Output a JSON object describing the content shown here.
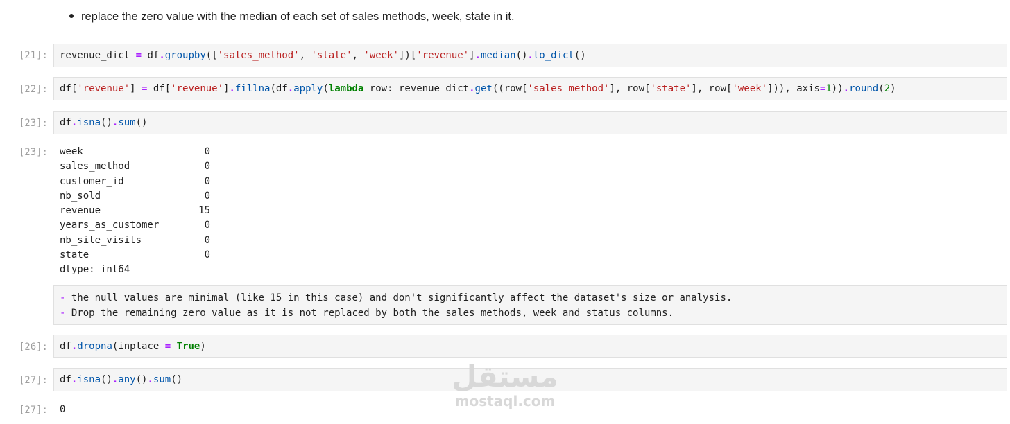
{
  "markdown": {
    "bullet": "replace the zero value with the median of each set of sales methods, week, state in it."
  },
  "cells": {
    "c21": {
      "prompt": "[21]:"
    },
    "c22": {
      "prompt": "[22]:"
    },
    "c23": {
      "prompt": "[23]:"
    },
    "c26": {
      "prompt": "[26]:"
    },
    "c27": {
      "prompt": "[27]:"
    }
  },
  "output23": {
    "prompt": "[23]:",
    "rows": [
      {
        "name": "week",
        "value": "0"
      },
      {
        "name": "sales_method",
        "value": "0"
      },
      {
        "name": "customer_id",
        "value": "0"
      },
      {
        "name": "nb_sold",
        "value": "0"
      },
      {
        "name": "revenue",
        "value": "15"
      },
      {
        "name": "years_as_customer",
        "value": "0"
      },
      {
        "name": "nb_site_visits",
        "value": "0"
      },
      {
        "name": "state",
        "value": "0"
      }
    ],
    "dtype": "dtype: int64"
  },
  "note": {
    "line1": "the null values are minimal (like 15 in this case) and don't significantly affect the dataset's size or analysis.",
    "line2": "Drop the remaining zero value as it is not replaced by both the sales methods, week and status columns."
  },
  "output27": {
    "prompt": "[27]:",
    "value": "0"
  },
  "watermark": {
    "arabic": "مستقل",
    "latin": "mostaql.com"
  }
}
